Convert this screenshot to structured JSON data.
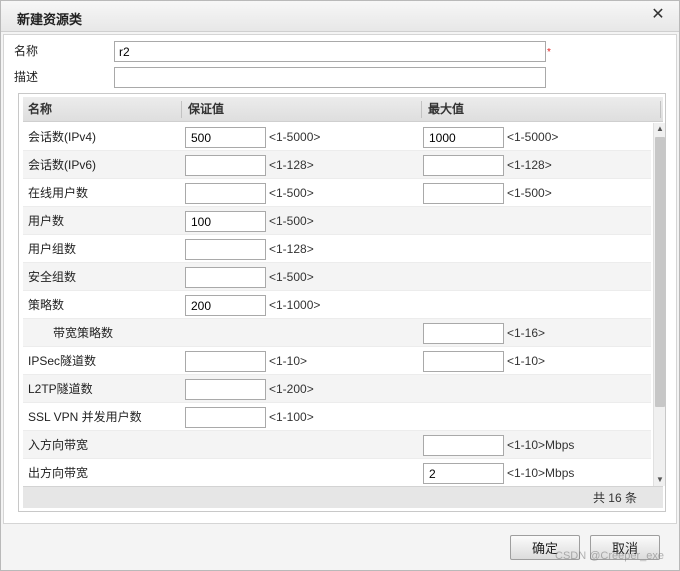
{
  "dialog": {
    "title": "新建资源类",
    "close_glyph": "✕"
  },
  "form": {
    "name_label": "名称",
    "name_value": "r2",
    "required_mark": "*",
    "desc_label": "描述",
    "desc_value": ""
  },
  "grid": {
    "columns": {
      "name": "名称",
      "guaranteed": "保证值",
      "max": "最大值"
    },
    "rows": [
      {
        "name": "会话数(IPv4)",
        "indent": false,
        "guaranteed": "500",
        "guaranteed_range": "<1-5000>",
        "max": "1000",
        "max_range": "<1-5000>"
      },
      {
        "name": "会话数(IPv6)",
        "indent": false,
        "guaranteed": "",
        "guaranteed_range": "<1-128>",
        "max": "",
        "max_range": "<1-128>"
      },
      {
        "name": "在线用户数",
        "indent": false,
        "guaranteed": "",
        "guaranteed_range": "<1-500>",
        "max": "",
        "max_range": "<1-500>"
      },
      {
        "name": "用户数",
        "indent": false,
        "guaranteed": "100",
        "guaranteed_range": "<1-500>",
        "max": null,
        "max_range": null
      },
      {
        "name": "用户组数",
        "indent": false,
        "guaranteed": "",
        "guaranteed_range": "<1-128>",
        "max": null,
        "max_range": null
      },
      {
        "name": "安全组数",
        "indent": false,
        "guaranteed": "",
        "guaranteed_range": "<1-500>",
        "max": null,
        "max_range": null
      },
      {
        "name": "策略数",
        "indent": false,
        "guaranteed": "200",
        "guaranteed_range": "<1-1000>",
        "max": null,
        "max_range": null
      },
      {
        "name": "带宽策略数",
        "indent": true,
        "guaranteed": null,
        "guaranteed_range": null,
        "max": "",
        "max_range": "<1-16>"
      },
      {
        "name": "IPSec隧道数",
        "indent": false,
        "guaranteed": "",
        "guaranteed_range": "<1-10>",
        "max": "",
        "max_range": "<1-10>"
      },
      {
        "name": "L2TP隧道数",
        "indent": false,
        "guaranteed": "",
        "guaranteed_range": "<1-200>",
        "max": null,
        "max_range": null
      },
      {
        "name": "SSL VPN 并发用户数",
        "indent": false,
        "guaranteed": "",
        "guaranteed_range": "<1-100>",
        "max": null,
        "max_range": null
      },
      {
        "name": "入方向带宽",
        "indent": false,
        "guaranteed": null,
        "guaranteed_range": null,
        "max": "",
        "max_range": "<1-10>Mbps"
      },
      {
        "name": "出方向带宽",
        "indent": false,
        "guaranteed": null,
        "guaranteed_range": null,
        "max": "2",
        "max_range": "<1-10>Mbps"
      }
    ],
    "total_text": "共 16 条"
  },
  "scrollbar": {
    "up_glyph": "▲",
    "down_glyph": "▼"
  },
  "buttons": {
    "ok": "确定",
    "cancel": "取消"
  },
  "watermark": "CSDN @Creeper_exe",
  "colors": {
    "required": "#e02020",
    "header_bg": "#e4e4e4",
    "row_alt_bg": "#f4f4f4"
  }
}
